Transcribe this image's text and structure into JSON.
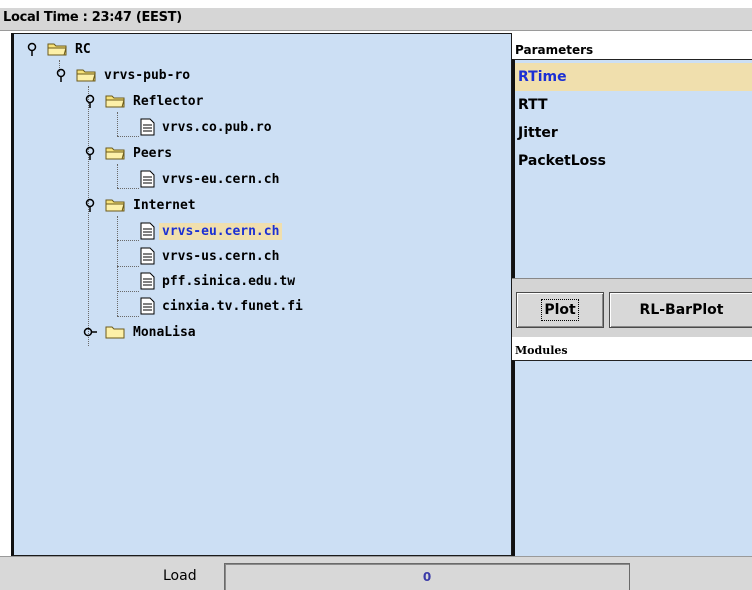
{
  "header": {
    "local_time": "Local Time : 23:47 (EEST)"
  },
  "tree": {
    "nodes": [
      {
        "label": "RC",
        "type": "folder",
        "expanded": true
      },
      {
        "label": "vrvs-pub-ro",
        "type": "folder",
        "expanded": true
      },
      {
        "label": "Reflector",
        "type": "folder",
        "expanded": true
      },
      {
        "label": "vrvs.co.pub.ro",
        "type": "file"
      },
      {
        "label": "Peers",
        "type": "folder",
        "expanded": true
      },
      {
        "label": "vrvs-eu.cern.ch",
        "type": "file"
      },
      {
        "label": "Internet",
        "type": "folder",
        "expanded": true
      },
      {
        "label": "vrvs-eu.cern.ch",
        "type": "file",
        "selected": true
      },
      {
        "label": "vrvs-us.cern.ch",
        "type": "file"
      },
      {
        "label": "pff.sinica.edu.tw",
        "type": "file"
      },
      {
        "label": "cinxia.tv.funet.fi",
        "type": "file"
      },
      {
        "label": "MonaLisa",
        "type": "folder",
        "expanded": false
      }
    ]
  },
  "parameters": {
    "title": "Parameters",
    "items": [
      "RTime",
      "RTT",
      "Jitter",
      "PacketLoss"
    ],
    "selected": "RTime"
  },
  "buttons": {
    "plot": "Plot",
    "rl_barplot": "RL-BarPlot"
  },
  "modules": {
    "title": "Modules"
  },
  "status": {
    "load_label": "Load",
    "load_value": "0"
  },
  "colors": {
    "panel_bg": "#ccdff4",
    "selection_bg": "#f0dfad",
    "selection_text": "#1b2fd4",
    "folder_yellow": "#f7e27a"
  }
}
